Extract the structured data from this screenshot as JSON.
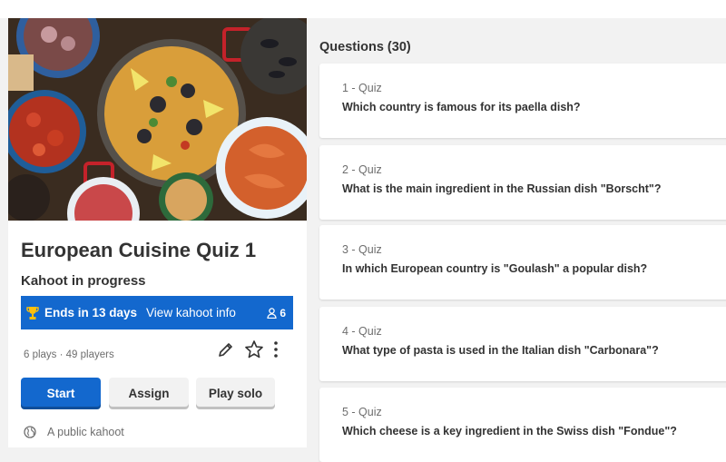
{
  "kahoot": {
    "title": "European Cuisine Quiz 1",
    "status": "Kahoot in progress",
    "ends_label": "Ends in 13 days",
    "info_link": "View kahoot info",
    "participants": "6",
    "stats": "6 plays · 49 players",
    "visibility": "A public kahoot",
    "buttons": {
      "start": "Start",
      "assign": "Assign",
      "solo": "Play solo"
    }
  },
  "questions": {
    "heading": "Questions (30)",
    "items": [
      {
        "type": "1 - Quiz",
        "text": "Which country is famous for its paella dish?"
      },
      {
        "type": "2 - Quiz",
        "text": "What is the main ingredient in the Russian dish \"Borscht\"?"
      },
      {
        "type": "3 - Quiz",
        "text": "In which European country is \"Goulash\" a popular dish?"
      },
      {
        "type": "4 - Quiz",
        "text": "What type of pasta is used in the Italian dish \"Carbonara\"?"
      },
      {
        "type": "5 - Quiz",
        "text": "Which cheese is a key ingredient in the Swiss dish \"Fondue\"?"
      }
    ]
  },
  "icons": [
    "trophy-icon",
    "person-icon",
    "edit-pencil-icon",
    "favorite-star-icon",
    "more-options-icon",
    "globe-icon"
  ],
  "colors": {
    "accent": "#1368ce",
    "background": "#f2f2f2",
    "card": "#ffffff",
    "text": "#333333",
    "muted": "#6e6e6e"
  }
}
